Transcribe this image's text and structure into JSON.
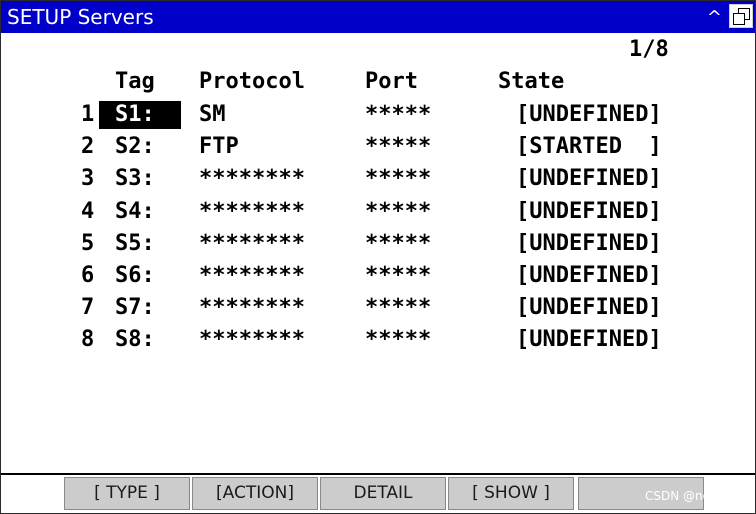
{
  "titlebar": {
    "title": "SETUP Servers",
    "caret": "^",
    "icons": [
      "caret-up-icon",
      "restore-window-icon"
    ]
  },
  "page_indicator": "1/8",
  "headers": {
    "tag": "Tag",
    "protocol": "Protocol",
    "port": "Port",
    "state": "State"
  },
  "rows": [
    {
      "num": "1",
      "tag": "S1:",
      "protocol": "SM",
      "port": "*****",
      "state": "[UNDEFINED]",
      "selected": true
    },
    {
      "num": "2",
      "tag": "S2:",
      "protocol": "FTP",
      "port": "*****",
      "state": "[STARTED  ]"
    },
    {
      "num": "3",
      "tag": "S3:",
      "protocol": "********",
      "port": "*****",
      "state": "[UNDEFINED]"
    },
    {
      "num": "4",
      "tag": "S4:",
      "protocol": "********",
      "port": "*****",
      "state": "[UNDEFINED]"
    },
    {
      "num": "5",
      "tag": "S5:",
      "protocol": "********",
      "port": "*****",
      "state": "[UNDEFINED]"
    },
    {
      "num": "6",
      "tag": "S6:",
      "protocol": "********",
      "port": "*****",
      "state": "[UNDEFINED]"
    },
    {
      "num": "7",
      "tag": "S7:",
      "protocol": "********",
      "port": "*****",
      "state": "[UNDEFINED]"
    },
    {
      "num": "8",
      "tag": "S8:",
      "protocol": "********",
      "port": "*****",
      "state": "[UNDEFINED]"
    }
  ],
  "softkeys": {
    "f1": "[ TYPE ]",
    "f2": "[ACTION]",
    "f3": "DETAIL",
    "f4": "[ SHOW ]",
    "f5": ""
  },
  "watermark": "CSDN @norlight",
  "colors": {
    "titlebar": "#0000c8",
    "softkey": "#cccccc",
    "selection": "#000000"
  }
}
